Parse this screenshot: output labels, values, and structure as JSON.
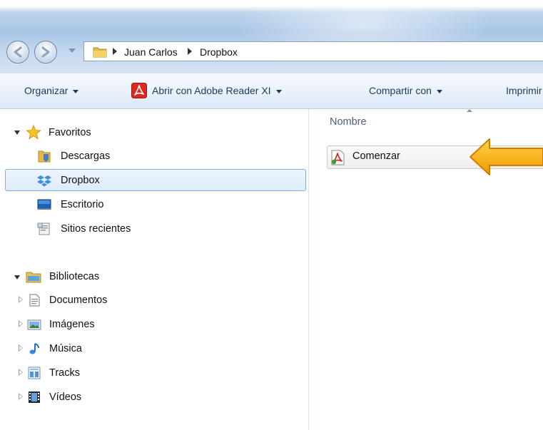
{
  "address": {
    "crumbs": [
      "Juan Carlos",
      "Dropbox"
    ]
  },
  "toolbar": {
    "organize": "Organizar",
    "open_with": "Abrir con Adobe Reader XI",
    "share": "Compartir con",
    "print": "Imprimir"
  },
  "nav": {
    "favorites": {
      "label": "Favoritos",
      "items": [
        "Descargas",
        "Dropbox",
        "Escritorio",
        "Sitios recientes"
      ],
      "selected": "Dropbox"
    },
    "libraries": {
      "label": "Bibliotecas",
      "items": [
        "Documentos",
        "Imágenes",
        "Música",
        "Tracks",
        "Vídeos"
      ]
    }
  },
  "files": {
    "column_name": "Nombre",
    "items": [
      {
        "name": "Comenzar",
        "icon": "pdf-file-icon"
      }
    ]
  },
  "annotation": {
    "arrow_color": "#f5a406",
    "arrow_points_to": "Comenzar"
  },
  "colors": {
    "selection": "#dcebfc",
    "selection_border": "#84acdd",
    "command_text": "#1e3958"
  }
}
